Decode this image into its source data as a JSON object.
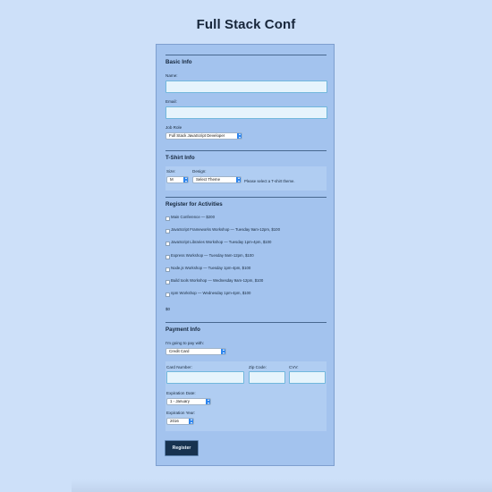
{
  "page": {
    "title": "Full Stack Conf"
  },
  "basic_info": {
    "legend": "Basic Info",
    "name_label": "Name:",
    "email_label": "Email:",
    "job_role_label": "Job Role",
    "job_role_value": "Full Stack JavaScript Developer"
  },
  "tshirt": {
    "legend": "T-Shirt Info",
    "size_label": "Size:",
    "size_value": "M",
    "design_label": "Design:",
    "design_value": "Select Theme",
    "hint": "Please select a T-shirt theme."
  },
  "activities": {
    "legend": "Register for Activities",
    "items": [
      {
        "label": "Main Conference — $200"
      },
      {
        "label": "JavaScript Frameworks Workshop — Tuesday 9am-12pm, $100"
      },
      {
        "label": "JavaScript Libraries Workshop — Tuesday 1pm-4pm, $100"
      },
      {
        "label": "Express Workshop — Tuesday 9am-12pm, $100"
      },
      {
        "label": "Node.js Workshop — Tuesday 1pm-4pm, $100"
      },
      {
        "label": "Build tools Workshop — Wednesday 9am-12pm, $100"
      },
      {
        "label": "npm Workshop — Wednesday 1pm-4pm, $100"
      }
    ],
    "total": "$0"
  },
  "payment": {
    "legend": "Payment Info",
    "pay_with_label": "I'm going to pay with:",
    "pay_with_value": "Credit Card",
    "card_number_label": "Card Number:",
    "zip_label": "Zip Code:",
    "cvv_label": "CVV:",
    "exp_date_label": "Expiration Date:",
    "exp_date_value": "1 - January",
    "exp_year_label": "Expiration Year:",
    "exp_year_value": "2016"
  },
  "submit": {
    "label": "Register"
  },
  "icons": {
    "select_arrow": "updown-chevron-icon"
  },
  "colors": {
    "background": "#cde0f9",
    "form": "#a3c3ee",
    "button": "#17324f",
    "select_accent": "#2f86ee"
  }
}
